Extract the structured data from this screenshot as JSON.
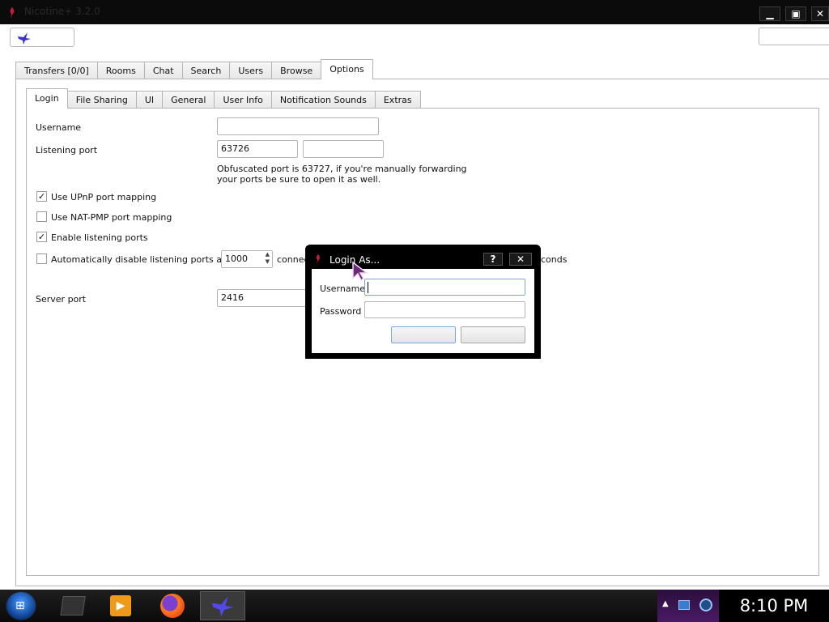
{
  "window": {
    "title": "Nicotine+ 3.2.0"
  },
  "main_tabs": [
    "Transfers [0/0]",
    "Rooms",
    "Chat",
    "Search",
    "Users",
    "Browse",
    "Options"
  ],
  "sub_tabs": [
    "Login",
    "File Sharing",
    "UI",
    "General",
    "User Info",
    "Notification Sounds",
    "Extras"
  ],
  "form": {
    "username_label": "Username",
    "username_value": "",
    "listening_port_label": "Listening port",
    "listening_port_value": "63726",
    "obfuscated_note_line1": "Obfuscated port is 63727, if you're manually forwarding",
    "obfuscated_note_line2": "your ports be sure to open it as well.",
    "upnp_label": "Use UPnP port mapping",
    "upnp_checked": true,
    "natpmp_label": "Use NAT-PMP port mapping",
    "natpmp_checked": false,
    "enable_listening_label": "Enable listening ports",
    "enable_listening_checked": true,
    "auto_disable_label": "Automatically disable listening ports after",
    "auto_disable_checked": false,
    "auto_disable_value": "1000",
    "auto_disable_suffix_left": "connec",
    "auto_disable_suffix_right": "conds",
    "server_port_label": "Server port",
    "server_port_value": "2416"
  },
  "dialog": {
    "title": "Login As...",
    "help": "?",
    "close": "✕",
    "username_label": "Username",
    "password_label": "Password",
    "username_value": "",
    "password_value": ""
  },
  "taskbar": {
    "clock": "8:10 PM"
  },
  "colors": {
    "accent": "#7aa7d8",
    "taskbar": "#111111",
    "tray_purple": "#5a1a7a"
  }
}
